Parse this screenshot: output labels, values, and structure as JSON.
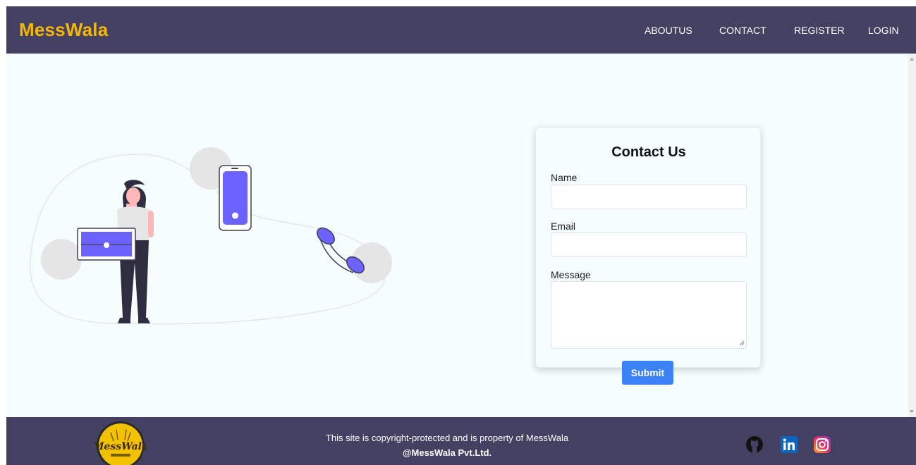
{
  "navbar": {
    "brand": "MessWala",
    "links": [
      "ABOUTUS",
      "CONTACT",
      "REGISTER",
      "LOGIN"
    ]
  },
  "contact_form": {
    "title": "Contact Us",
    "name_label": "Name",
    "name_value": "",
    "email_label": "Email",
    "email_value": "",
    "message_label": "Message",
    "message_value": "",
    "submit_label": "Submit"
  },
  "footer": {
    "logo_text": "MessWala",
    "line1": "This site is copyright-protected and is property of MessWala",
    "line2": "@MessWala Pvt.Ltd.",
    "social": [
      "github-icon",
      "linkedin-icon",
      "instagram-icon"
    ]
  },
  "colors": {
    "navbar_bg": "#434061",
    "brand": "#f5b800",
    "page_bg": "#f5fdfd",
    "accent_purple": "#6c63ff",
    "button": "#3b82f6"
  }
}
